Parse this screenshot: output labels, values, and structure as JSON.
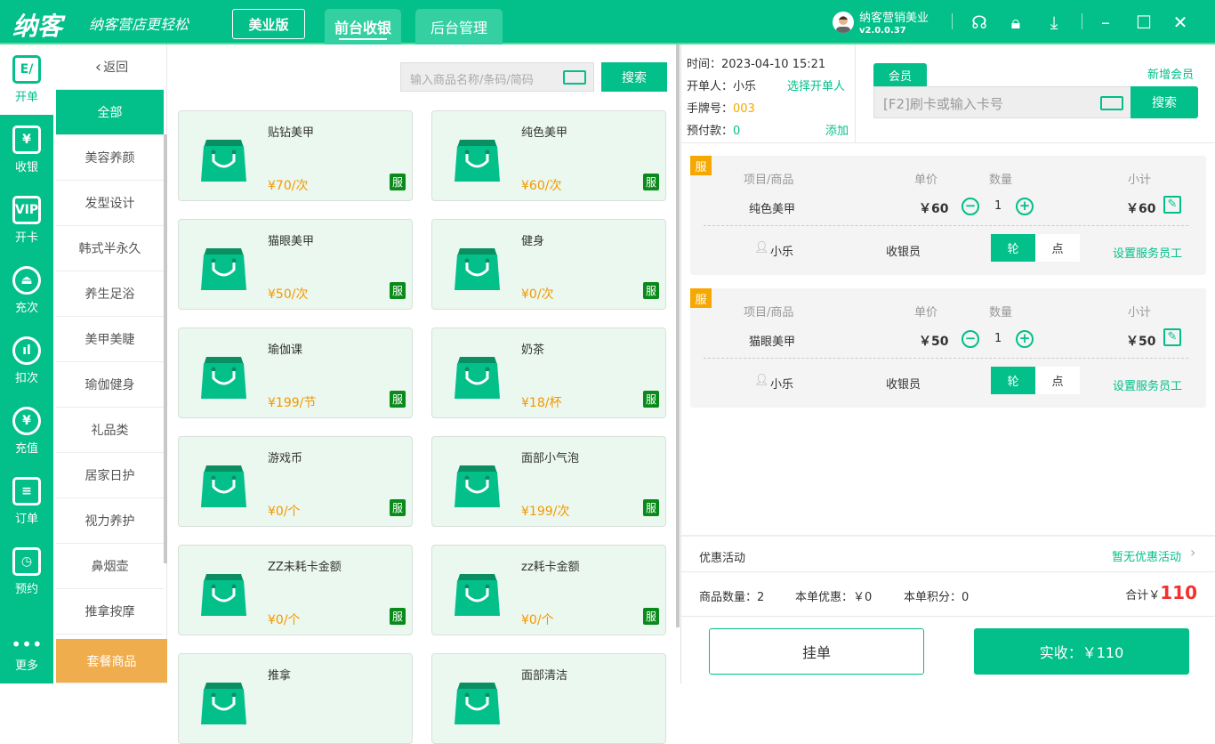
{
  "header": {
    "logo": "纳客",
    "slogan": "纳客营店更轻松",
    "edition": "美业版",
    "tabs": [
      {
        "label": "前台收银"
      },
      {
        "label": "后台管理"
      }
    ],
    "user": "纳客营销美业",
    "version": "v2.0.0.37"
  },
  "nav": [
    {
      "label": "开单",
      "icon": "E/"
    },
    {
      "label": "收银",
      "icon": "¥"
    },
    {
      "label": "开卡",
      "icon": "VIP"
    },
    {
      "label": "充次",
      "icon": "⏏"
    },
    {
      "label": "扣次",
      "icon": "ıl"
    },
    {
      "label": "充值",
      "icon": "¥"
    },
    {
      "label": "订单",
      "icon": "≡"
    },
    {
      "label": "预约",
      "icon": "◷"
    },
    {
      "label": "更多",
      "icon": "•••"
    }
  ],
  "categories": {
    "back": "返回",
    "items": [
      "全部",
      "美容养颜",
      "发型设计",
      "韩式半永久",
      "养生足浴",
      "美甲美睫",
      "瑜伽健身",
      "礼品类",
      "居家日护",
      "视力养护",
      "鼻烟壶",
      "推拿按摩"
    ],
    "package": "套餐商品"
  },
  "search": {
    "placeholder": "输入商品名称/条码/简码",
    "button": "搜索"
  },
  "products": [
    {
      "name": "贴钻美甲",
      "price": "¥70/次",
      "tag": "服"
    },
    {
      "name": "纯色美甲",
      "price": "¥60/次",
      "tag": "服"
    },
    {
      "name": "猫眼美甲",
      "price": "¥50/次",
      "tag": "服"
    },
    {
      "name": "健身",
      "price": "¥0/次",
      "tag": "服"
    },
    {
      "name": "瑜伽课",
      "price": "¥199/节",
      "tag": "服"
    },
    {
      "name": "奶茶",
      "price": "¥18/杯",
      "tag": "服"
    },
    {
      "name": "游戏币",
      "price": "¥0/个",
      "tag": "服"
    },
    {
      "name": "面部小气泡",
      "price": "¥199/次",
      "tag": "服"
    },
    {
      "name": "ZZ未耗卡金额",
      "price": "¥0/个",
      "tag": "服"
    },
    {
      "name": "zz耗卡金额",
      "price": "¥0/个",
      "tag": "服"
    },
    {
      "name": "推拿",
      "price": "",
      "tag": ""
    },
    {
      "name": "面部清洁",
      "price": "",
      "tag": ""
    }
  ],
  "order_info": {
    "time_label": "时间：",
    "time": "2023-04-10 15:21",
    "opener_label": "开单人：",
    "opener": "小乐",
    "select_opener": "选择开单人",
    "tag_label": "手牌号：",
    "tag_no": "003",
    "prepay_label": "预付款：",
    "prepay": "0",
    "add": "添加"
  },
  "member": {
    "tab": "会员",
    "new": "新增会员",
    "placeholder": "[F2]刷卡或输入卡号",
    "button": "搜索"
  },
  "order_headers": {
    "item": "项目/商品",
    "price": "单价",
    "qty": "数量",
    "subtotal": "小计"
  },
  "order_items": [
    {
      "tag": "服",
      "name": "纯色美甲",
      "price": "￥60",
      "qty": "1",
      "subtotal": "￥60",
      "staff": "小乐",
      "role": "收银员",
      "mode_a": "轮",
      "mode_b": "点",
      "set_staff": "设置服务员工"
    },
    {
      "tag": "服",
      "name": "猫眼美甲",
      "price": "￥50",
      "qty": "1",
      "subtotal": "￥50",
      "staff": "小乐",
      "role": "收银员",
      "mode_a": "轮",
      "mode_b": "点",
      "set_staff": "设置服务员工"
    }
  ],
  "promo": {
    "label": "优惠活动",
    "value": "暂无优惠活动"
  },
  "summary": {
    "count": "商品数量：2",
    "discount": "本单优惠：￥0",
    "points": "本单积分：0",
    "total_label": "合计￥",
    "total": "110"
  },
  "actions": {
    "hold": "挂单",
    "pay": "实收：￥110"
  },
  "colors": {
    "brand": "#03bf8a",
    "accent": "#f39800",
    "total": "#f23030"
  }
}
